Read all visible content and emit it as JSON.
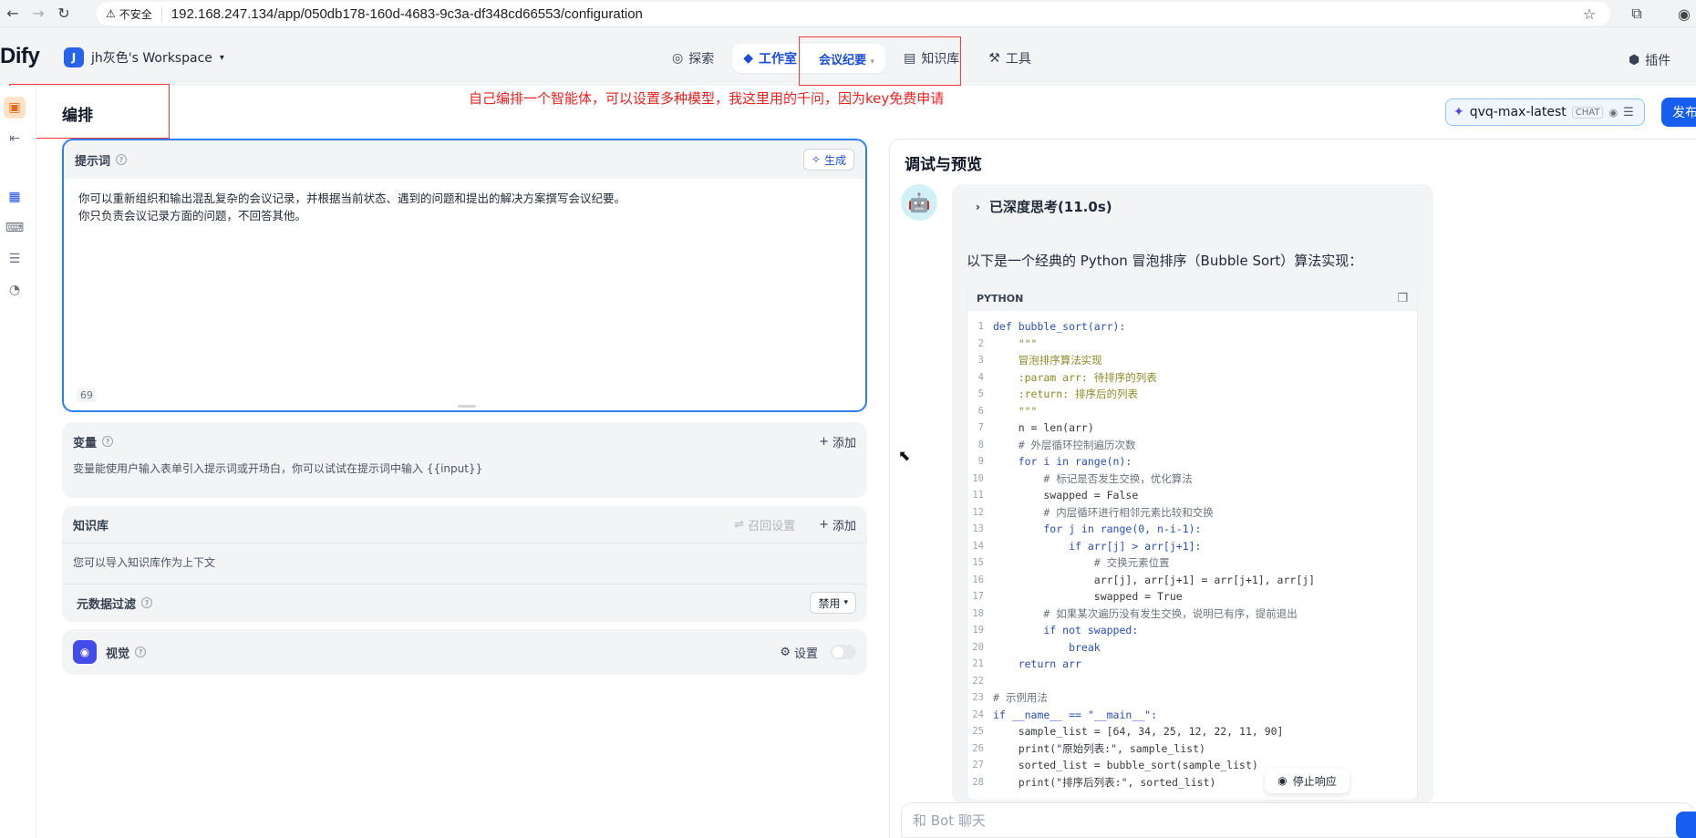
{
  "browser": {
    "insecure_label": "不安全",
    "url": "192.168.247.134/app/050db178-160d-4683-9c3a-df348cd66553/configuration"
  },
  "header": {
    "logo": "Dify",
    "workspace_initial": "J",
    "workspace_name": "jh灰色's Workspace",
    "nav": {
      "explore": "探索",
      "studio": "工作室",
      "app_name": "会议纪要",
      "knowledge": "知识库",
      "tools": "工具"
    },
    "plugins": "插件"
  },
  "annotation_text": "自己编排一个智能体，可以设置多种模型，我这里用的千问，因为key免费申请",
  "orchestrate": {
    "title": "编排",
    "model_name": "qvq-max-latest",
    "model_badge": "CHAT",
    "publish": "发布"
  },
  "prompt": {
    "label": "提示词",
    "generate": "生成",
    "line1": "你可以重新组织和输出混乱复杂的会议记录，并根据当前状态、遇到的问题和提出的解决方案撰写会议纪要。",
    "line2": "你只负责会议记录方面的问题，不回答其他。",
    "char_count": "69"
  },
  "variables": {
    "label": "变量",
    "add": "添加",
    "desc": "变量能使用户输入表单引入提示词或开场白，你可以试试在提示词中输入 {{input}}"
  },
  "knowledge": {
    "label": "知识库",
    "recall_settings": "召回设置",
    "add": "添加",
    "desc": "您可以导入知识库作为上下文",
    "metadata_filter": "元数据过滤",
    "metadata_value": "禁用"
  },
  "vision": {
    "label": "视觉",
    "settings": "设置"
  },
  "debug": {
    "title": "调试与预览",
    "thinking": "已深度思考(11.0s)",
    "intro": "以下是一个经典的 Python 冒泡排序（Bubble Sort）算法实现：",
    "code_lang": "PYTHON",
    "code_lines": [
      {
        "n": "1",
        "t": "def bubble_sort(arr):"
      },
      {
        "n": "2",
        "t": "    \"\"\""
      },
      {
        "n": "3",
        "t": "    冒泡排序算法实现"
      },
      {
        "n": "4",
        "t": "    :param arr: 待排序的列表"
      },
      {
        "n": "5",
        "t": "    :return: 排序后的列表"
      },
      {
        "n": "6",
        "t": "    \"\"\""
      },
      {
        "n": "7",
        "t": "    n = len(arr)"
      },
      {
        "n": "8",
        "t": "    # 外层循环控制遍历次数"
      },
      {
        "n": "9",
        "t": "    for i in range(n):"
      },
      {
        "n": "10",
        "t": "        # 标记是否发生交换，优化算法"
      },
      {
        "n": "11",
        "t": "        swapped = False"
      },
      {
        "n": "12",
        "t": "        # 内层循环进行相邻元素比较和交换"
      },
      {
        "n": "13",
        "t": "        for j in range(0, n-i-1):"
      },
      {
        "n": "14",
        "t": "            if arr[j] > arr[j+1]:"
      },
      {
        "n": "15",
        "t": "                # 交换元素位置"
      },
      {
        "n": "16",
        "t": "                arr[j], arr[j+1] = arr[j+1], arr[j]"
      },
      {
        "n": "17",
        "t": "                swapped = True"
      },
      {
        "n": "18",
        "t": "        # 如果某次遍历没有发生交换，说明已有序，提前退出"
      },
      {
        "n": "19",
        "t": "        if not swapped:"
      },
      {
        "n": "20",
        "t": "            break"
      },
      {
        "n": "21",
        "t": "    return arr"
      },
      {
        "n": "22",
        "t": ""
      },
      {
        "n": "23",
        "t": "# 示例用法"
      },
      {
        "n": "24",
        "t": "if __name__ == \"__main__\":"
      },
      {
        "n": "25",
        "t": "    sample_list = [64, 34, 25, 12, 22, 11, 90]"
      },
      {
        "n": "26",
        "t": "    print(\"原始列表:\", sample_list)"
      },
      {
        "n": "27",
        "t": "    sorted_list = bubble_sort(sample_list)"
      },
      {
        "n": "28",
        "t": "    print(\"排序后列表:\", sorted_list)"
      }
    ],
    "stop": "停止响应",
    "chat_placeholder": "和 Bot 聊天"
  },
  "colors": {
    "accent": "#155eef",
    "annotation_red": "#ef2020"
  }
}
